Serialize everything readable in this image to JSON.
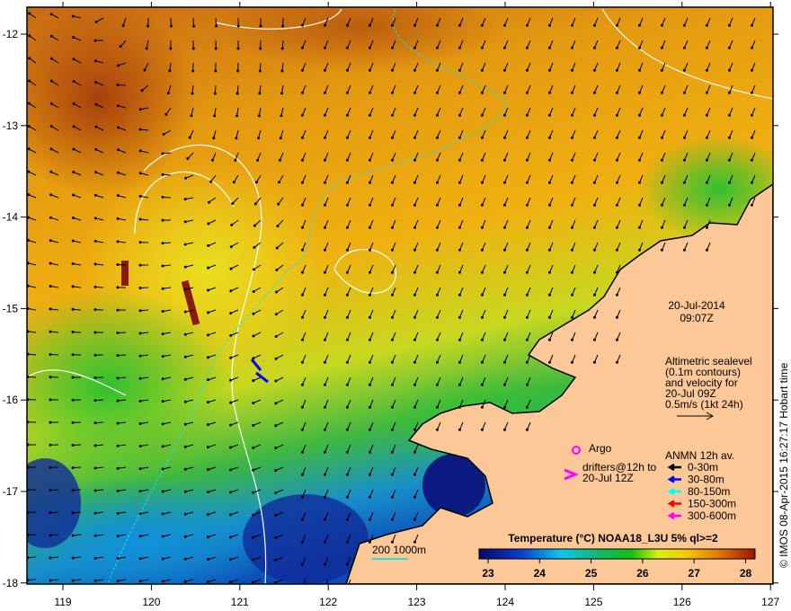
{
  "map": {
    "lon_ticks": [
      "119",
      "120",
      "121",
      "122",
      "123",
      "124",
      "125",
      "126",
      "127"
    ],
    "lat_ticks": [
      "-12",
      "-13",
      "-14",
      "-15",
      "-16",
      "-17",
      "-18"
    ],
    "date": "20-Jul-2014",
    "time": "09:07Z",
    "altimetry_note": [
      "Altimetric sealevel",
      "(0.1m contours)",
      "and velocity for",
      "20-Jul 09Z",
      "0.5m/s (1kt 24h)"
    ],
    "argo_label": "Argo",
    "drifters_label": [
      "drifters@12h to",
      "20-Jul 12Z"
    ],
    "anmn_title": "ANMN 12h av.",
    "anmn_legend": [
      {
        "label": "0-30m",
        "color": "#000000"
      },
      {
        "label": "30-80m",
        "color": "#0000ff"
      },
      {
        "label": "80-150m",
        "color": "#00ffff"
      },
      {
        "label": "150-300m",
        "color": "#ff0000"
      },
      {
        "label": "300-600m",
        "color": "#ff00ff"
      }
    ],
    "isobath_label": "200  1000m",
    "colorbar_title": "Temperature (°C) NOAA18_L3U 5% ql>=2",
    "colorbar_ticks": [
      "23",
      "24",
      "25",
      "26",
      "27",
      "28"
    ],
    "colorbar_range": [
      23,
      28
    ],
    "credit": "© IMOS 08-Apr-2015 16:27:17 Hobart time",
    "colors": {
      "land": "#fcc898",
      "warm": "#d98a10",
      "cool": "#0a2a8a"
    }
  }
}
